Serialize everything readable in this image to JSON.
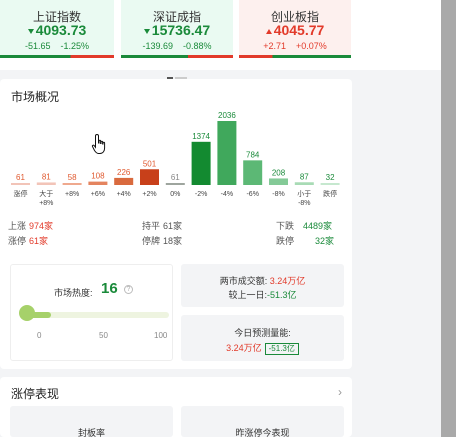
{
  "indices": [
    {
      "name": "上证指数",
      "value": "4093.73",
      "change": "-51.65",
      "pct": "-1.25%",
      "trend": "down"
    },
    {
      "name": "深证成指",
      "value": "15736.47",
      "change": "-139.69",
      "pct": "-0.88%",
      "trend": "down"
    },
    {
      "name": "创业板指",
      "value": "4045.77",
      "change": "+2.71",
      "pct": "+0.07%",
      "trend": "up"
    }
  ],
  "overview": {
    "title": "市场概况",
    "stats": {
      "up_label": "上涨",
      "up_value": "974家",
      "limit_up_label": "涨停",
      "limit_up_value": "61家",
      "flat_label": "持平",
      "flat_value": "61家",
      "halt_label": "停牌",
      "halt_value": "18家",
      "down_label": "下跌",
      "down_value": "4489家",
      "limit_down_label": "跌停",
      "limit_down_value": "32家"
    },
    "heat": {
      "label": "市场热度:",
      "value": "16",
      "help": "?",
      "ticks": [
        "0",
        "50",
        "100"
      ],
      "level": 16,
      "max": 100
    },
    "amount": {
      "label": "两市成交额:",
      "value": "3.24万亿",
      "compare_label": "较上一日:",
      "compare_value": "-51.3亿"
    },
    "prediction": {
      "label": "今日预测量能:",
      "value": "3.24万亿",
      "delta": "-51.3亿"
    }
  },
  "chart_data": {
    "type": "bar",
    "categories": [
      "涨停",
      "大于+8%",
      "+8%",
      "+6%",
      "+4%",
      "+2%",
      "0%",
      "-2%",
      "-4%",
      "-6%",
      "-8%",
      "小于-8%",
      "跌停"
    ],
    "values": [
      61,
      81,
      58,
      108,
      226,
      501,
      61,
      1374,
      2036,
      784,
      208,
      87,
      32
    ],
    "colors": [
      "#f2c4b8",
      "#f2c4b8",
      "#efa98e",
      "#e4845f",
      "#d96a3e",
      "#c8401a",
      "#9ea59e",
      "#138a30",
      "#40a85c",
      "#5cb875",
      "#84ca97",
      "#a8dbb5",
      "#c6e8cf"
    ],
    "label_colors": [
      "#e05a30",
      "#e05a30",
      "#e05a30",
      "#e05a30",
      "#e05a30",
      "#e05a30",
      "#888888",
      "#1a8a3a",
      "#1a8a3a",
      "#1a8a3a",
      "#1a8a3a",
      "#1a8a3a",
      "#1a8a3a"
    ]
  },
  "limit_section": {
    "title": "涨停表现",
    "chevron": "›",
    "tab1": "封板率",
    "tab2": "昨涨停今表现"
  },
  "icons": {
    "cursor": "hand-pointer-icon"
  }
}
